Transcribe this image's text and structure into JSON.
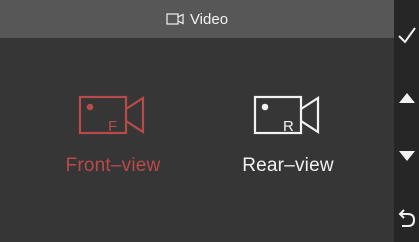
{
  "title": {
    "icon": "video-camera-outline-icon",
    "text": "Video"
  },
  "options": [
    {
      "id": "front",
      "icon": "front-camera-icon",
      "icon_letter": "F",
      "label": "Front–view",
      "selected": true,
      "color": "#b94a4a"
    },
    {
      "id": "rear",
      "icon": "rear-camera-icon",
      "icon_letter": "R",
      "label": "Rear–view",
      "selected": false,
      "color": "#f2f2f2"
    }
  ],
  "side_buttons": [
    {
      "id": "confirm",
      "icon": "checkmark-icon"
    },
    {
      "id": "up",
      "icon": "triangle-up-icon"
    },
    {
      "id": "down",
      "icon": "triangle-down-icon"
    },
    {
      "id": "back",
      "icon": "return-arrow-icon"
    }
  ],
  "colors": {
    "background": "#363636",
    "title_bar": "#575757",
    "side_bar": "#262626",
    "selected": "#b94a4a",
    "text": "#f2f2f2"
  }
}
